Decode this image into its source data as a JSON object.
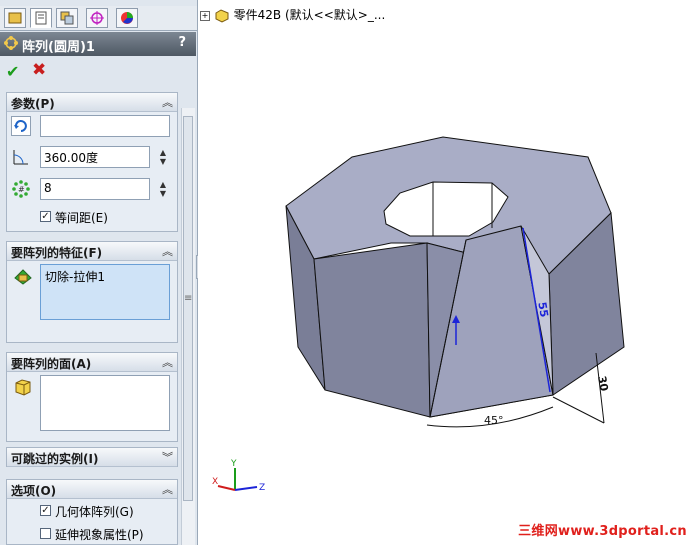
{
  "tabs": {
    "items": [
      {
        "icon": "feature-manager-icon"
      },
      {
        "icon": "property-manager-icon"
      },
      {
        "icon": "configuration-manager-icon"
      },
      {
        "icon": "dimxpert-icon"
      },
      {
        "icon": "display-manager-icon"
      }
    ]
  },
  "header": {
    "title": "阵列(圆周)1",
    "help": "?"
  },
  "actions": {
    "ok": "✔",
    "cancel": "✖"
  },
  "params": {
    "title": "参数(P)",
    "axis_value": "",
    "angle_value": "360.00度",
    "count_value": "8",
    "equal_spacing_label": "等间距(E)",
    "equal_spacing_checked": true
  },
  "features": {
    "title": "要阵列的特征(F)",
    "items": [
      "切除-拉伸1"
    ]
  },
  "faces": {
    "title": "要阵列的面(A)"
  },
  "skip": {
    "title": "可跳过的实例(I)"
  },
  "options": {
    "title": "选项(O)",
    "geometry_pattern_label": "几何体阵列(G)",
    "geometry_pattern_checked": true,
    "propagate_label": "延伸视象属性(P)",
    "propagate_checked": false
  },
  "tree": {
    "label": "零件42B   (默认<<默认>_..."
  },
  "dimensions": {
    "d1": "55",
    "d2": "30",
    "d3": "45°"
  },
  "triad": {
    "x": "X",
    "y": "Y",
    "z": "Z"
  },
  "watermark": "三维网www.3dportal.cn",
  "colors": {
    "model": "#8e92ac",
    "top": "#a9adc6",
    "accent": "#1c24d8"
  }
}
